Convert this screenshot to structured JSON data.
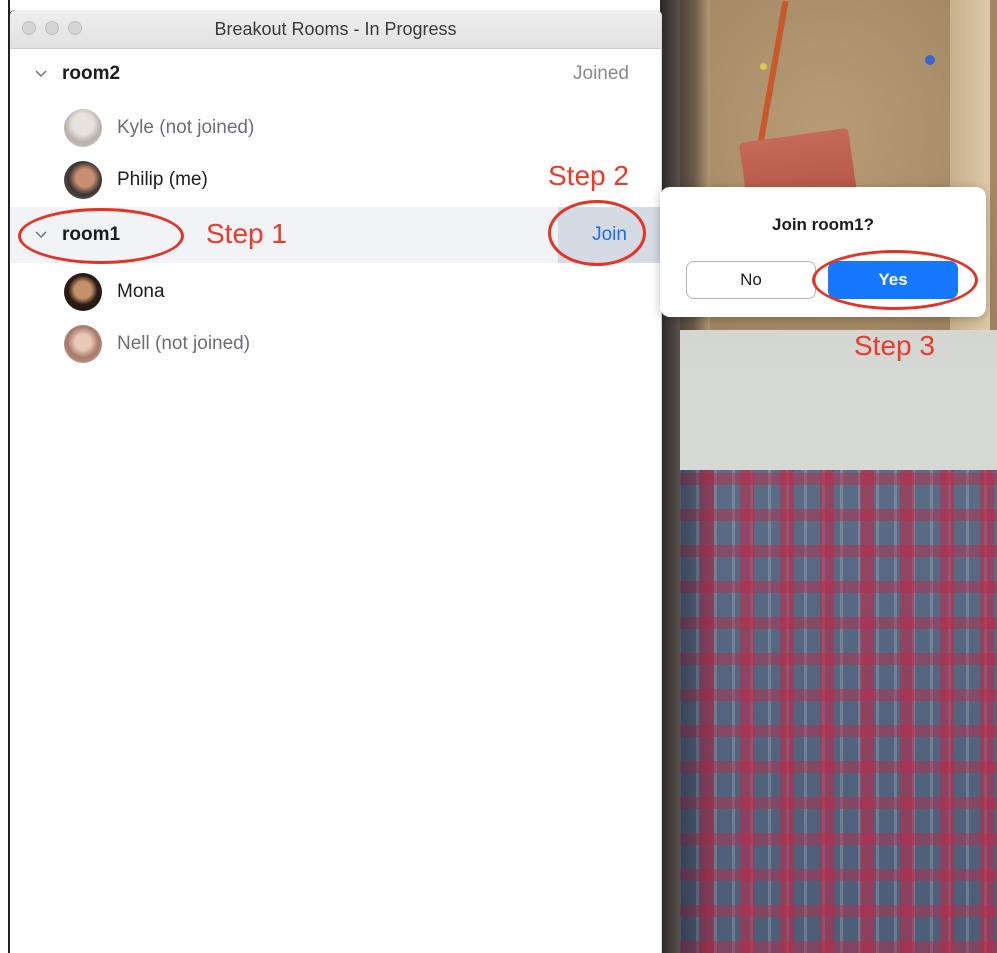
{
  "window": {
    "title": "Breakout Rooms - In Progress"
  },
  "rooms": [
    {
      "name": "room2",
      "status": "Joined",
      "participants": [
        {
          "name": "Kyle (not joined)",
          "joined": false
        },
        {
          "name": "Philip (me)",
          "joined": true
        }
      ]
    },
    {
      "name": "room1",
      "action": "Join",
      "participants": [
        {
          "name": "Mona",
          "joined": true
        },
        {
          "name": "Nell (not joined)",
          "joined": false
        }
      ]
    }
  ],
  "dialog": {
    "title": "Join room1?",
    "no_label": "No",
    "yes_label": "Yes"
  },
  "annotations": {
    "step1": "Step 1",
    "step2": "Step 2",
    "step3": "Step 3"
  },
  "colors": {
    "accent": "#1677ff",
    "annotation": "#ea3a2a",
    "join_text": "#1a6fe0"
  }
}
